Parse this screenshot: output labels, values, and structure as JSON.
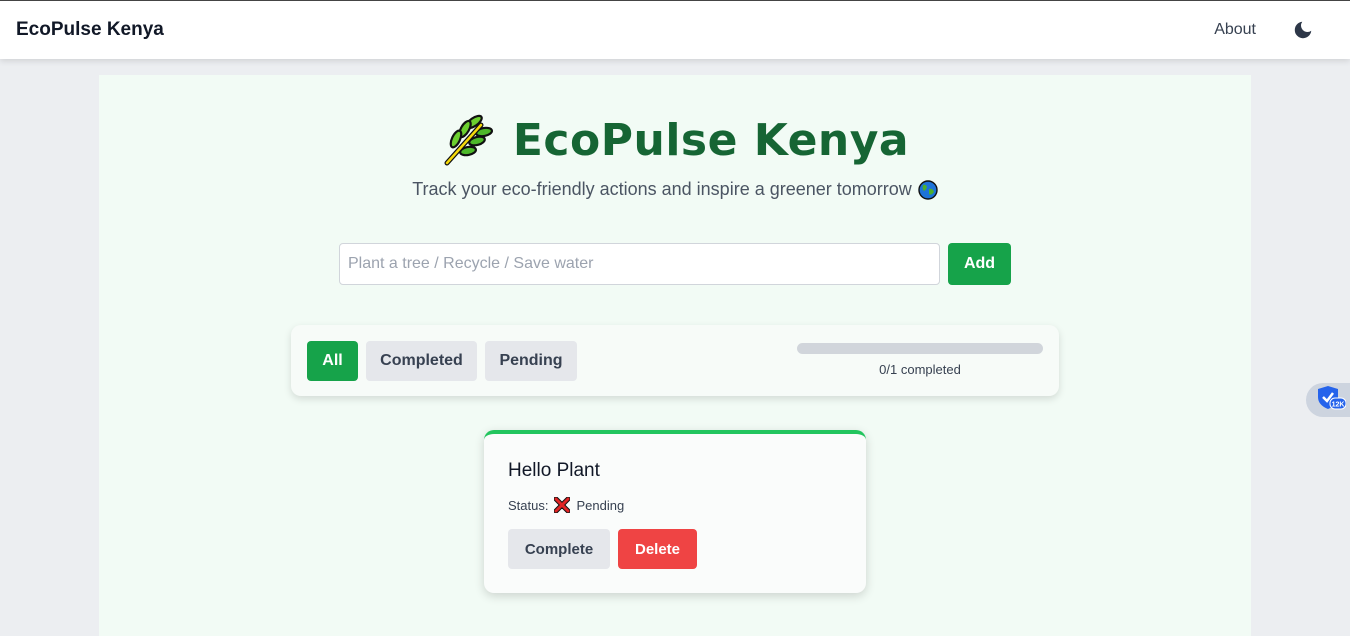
{
  "navbar": {
    "brand": "EcoPulse Kenya",
    "about_label": "About",
    "theme_icon": "moon-icon"
  },
  "hero": {
    "icon": "leaf-icon",
    "title": "EcoPulse Kenya",
    "subtitle": "Track your eco-friendly actions and inspire a greener tomorrow",
    "subtitle_icon": "globe-icon"
  },
  "form": {
    "placeholder": "Plant a tree / Recycle / Save water",
    "value": "",
    "add_label": "Add"
  },
  "filters": {
    "items": [
      {
        "label": "All",
        "active": true
      },
      {
        "label": "Completed",
        "active": false
      },
      {
        "label": "Pending",
        "active": false
      }
    ],
    "progress_fraction": 0,
    "progress_text": "0/1 completed"
  },
  "tasks": [
    {
      "title": "Hello Plant",
      "status_label": "Status:",
      "status_icon": "cross-mark-icon",
      "status": "Pending",
      "complete_label": "Complete",
      "delete_label": "Delete"
    }
  ],
  "extension_widget": {
    "badge": "12K",
    "icon": "shield-icon"
  },
  "colors": {
    "accent": "#16a34a",
    "title_green": "#166534",
    "card_top": "#22c55e",
    "danger": "#ef4444",
    "page_bg": "#eceef1",
    "container_bg": "#f2fbf5"
  }
}
